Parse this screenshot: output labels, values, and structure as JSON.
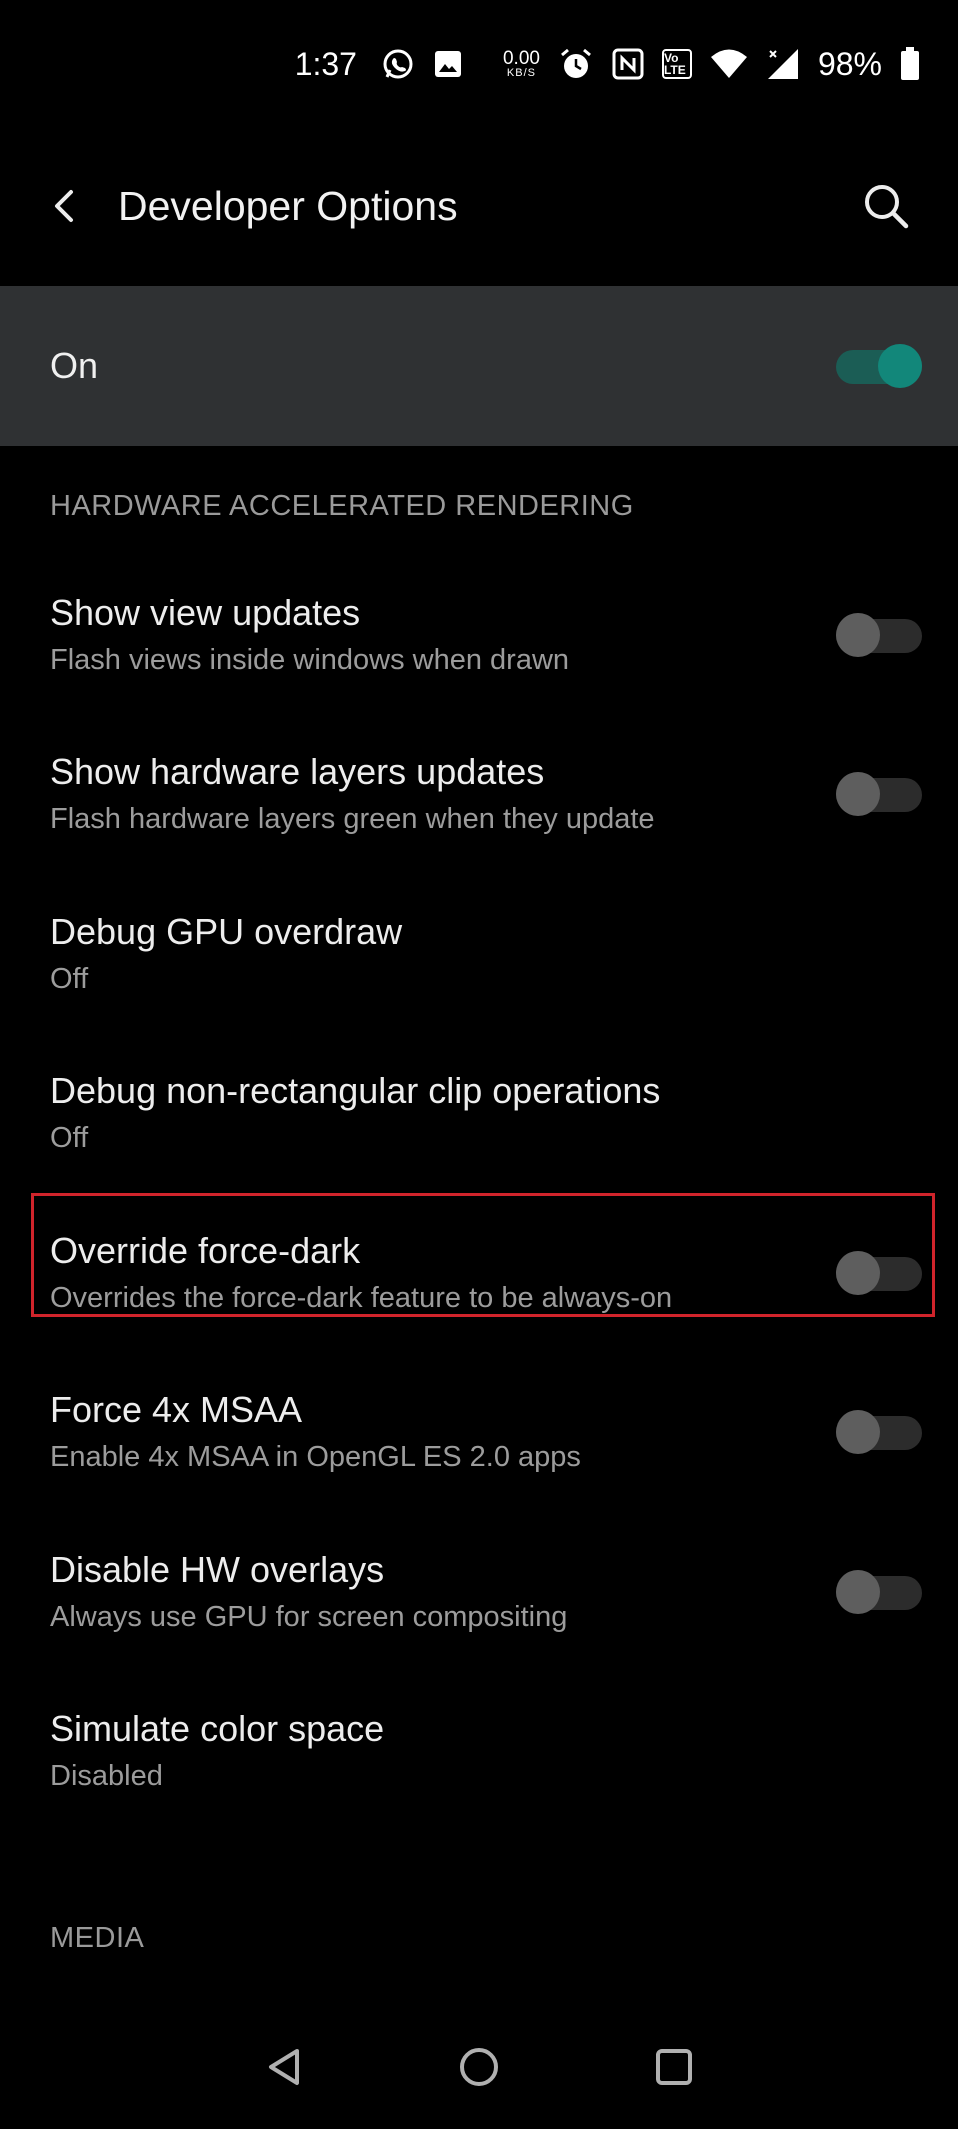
{
  "status_bar": {
    "time": "1:37",
    "speed_value": "0.00",
    "speed_unit": "KB/S",
    "volte_label": "Vo LTE",
    "battery": "98%",
    "icons": [
      "whatsapp-icon",
      "gallery-icon",
      "alarm-icon",
      "nfc-icon",
      "volte-icon",
      "wifi-icon",
      "signal-icon",
      "battery-icon"
    ]
  },
  "app_bar": {
    "title": "Developer Options",
    "icons": [
      "back-icon",
      "search-icon"
    ]
  },
  "master_switch": {
    "label": "On",
    "checked": true
  },
  "sections": [
    {
      "header": "HARDWARE ACCELERATED RENDERING"
    },
    {
      "header": "MEDIA"
    }
  ],
  "items": [
    {
      "title": "Show view updates",
      "summary": "Flash views inside windows when drawn",
      "has_toggle": true,
      "checked": false
    },
    {
      "title": "Show hardware layers updates",
      "summary": "Flash hardware layers green when they update",
      "has_toggle": true,
      "checked": false
    },
    {
      "title": "Debug GPU overdraw",
      "summary": "Off",
      "has_toggle": false
    },
    {
      "title": "Debug non-rectangular clip operations",
      "summary": "Off",
      "has_toggle": false
    },
    {
      "title": "Override force-dark",
      "summary": "Overrides the force-dark feature to be always-on",
      "has_toggle": true,
      "checked": false,
      "highlighted": true
    },
    {
      "title": "Force 4x MSAA",
      "summary": "Enable 4x MSAA in OpenGL ES 2.0 apps",
      "has_toggle": true,
      "checked": false
    },
    {
      "title": "Disable HW overlays",
      "summary": "Always use GPU for screen compositing",
      "has_toggle": true,
      "checked": false
    },
    {
      "title": "Simulate color space",
      "summary": "Disabled",
      "has_toggle": false
    }
  ],
  "colors": {
    "background": "#000000",
    "master_bar": "#2F3133",
    "accent_thumb": "#12877A",
    "accent_track": "#1B5D55",
    "highlight_border": "#D0242B"
  },
  "nav_bar": {
    "icons": [
      "nav-back-icon",
      "nav-home-icon",
      "nav-recents-icon"
    ]
  }
}
